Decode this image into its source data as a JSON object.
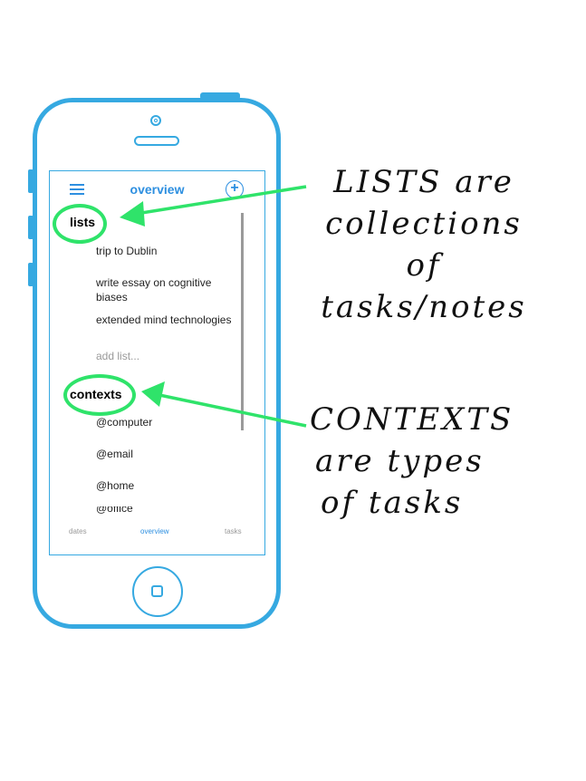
{
  "header": {
    "title": "overview",
    "add_symbol": "+"
  },
  "sections": {
    "lists": {
      "title": "lists",
      "items": [
        {
          "label": "trip to Dublin"
        },
        {
          "label": "write essay on cognitive biases"
        },
        {
          "label": "extended mind technologies"
        }
      ],
      "add_placeholder": "add list..."
    },
    "contexts": {
      "title": "contexts",
      "items": [
        {
          "label": "@computer"
        },
        {
          "label": "@email"
        },
        {
          "label": "@home"
        },
        {
          "label": "@office"
        }
      ]
    }
  },
  "tabs": [
    {
      "label": "dates",
      "active": false
    },
    {
      "label": "overview",
      "active": true
    },
    {
      "label": "tasks",
      "active": false
    }
  ],
  "annotations": {
    "lists_note": [
      "LISTS are",
      "collections",
      "of",
      "tasks/notes"
    ],
    "contexts_note": [
      "CONTEXTS",
      "are types",
      "of tasks"
    ]
  },
  "colors": {
    "phone": "#36a9e1",
    "accent": "#2d8fe0",
    "highlight": "#2fe36a"
  },
  "icons": {
    "menu": "hamburger-menu-icon",
    "add": "plus-circle-icon",
    "home": "home-button-icon"
  }
}
